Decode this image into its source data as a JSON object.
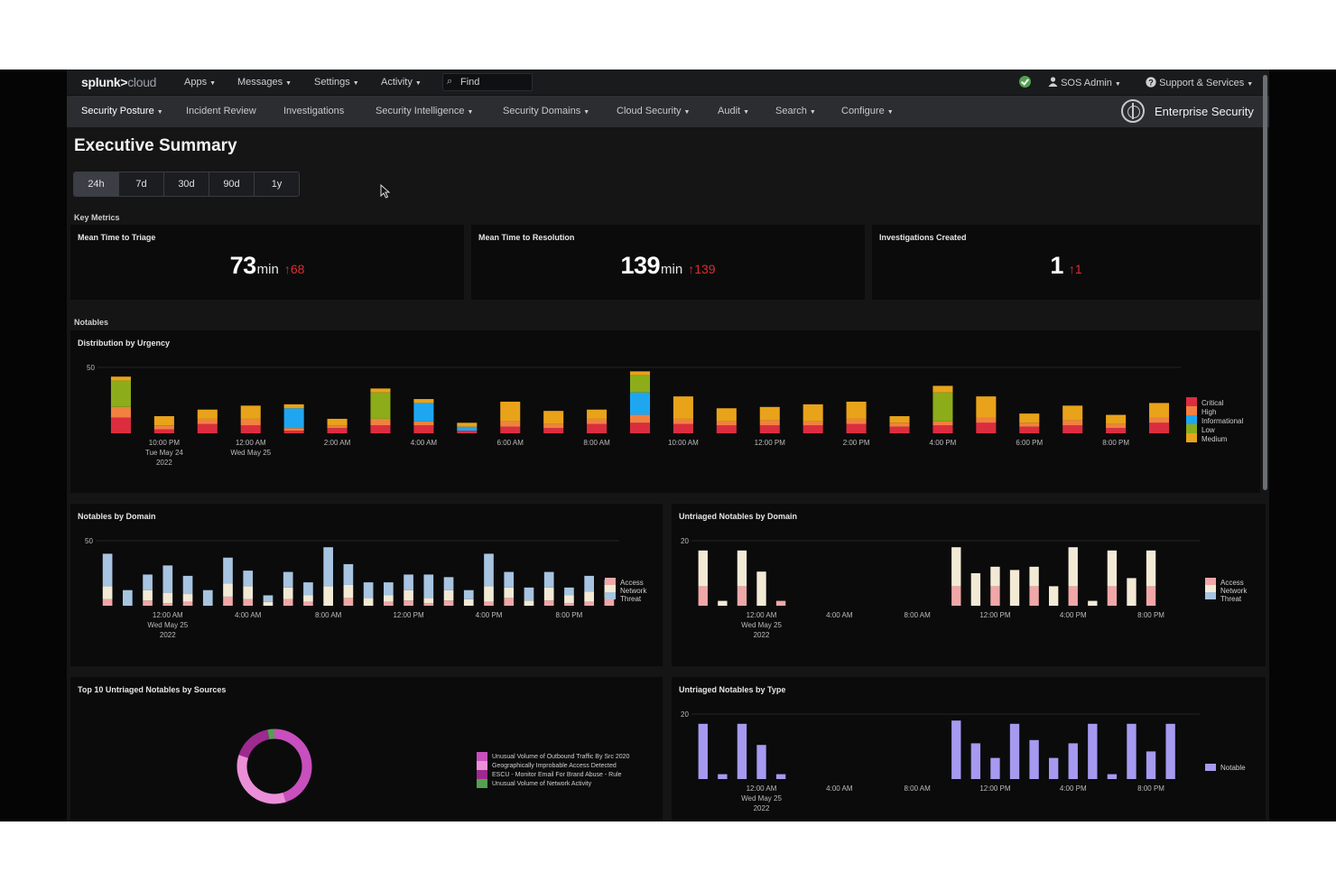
{
  "topbar": {
    "logo_main": "splunk>",
    "logo_sub": "cloud",
    "menus": [
      {
        "label": "Apps",
        "icon": "chevron-down-icon"
      },
      {
        "label": "Messages",
        "icon": "chevron-down-icon"
      },
      {
        "label": "Settings",
        "icon": "chevron-down-icon"
      },
      {
        "label": "Activity",
        "icon": "chevron-down-icon"
      }
    ],
    "find_placeholder": "Find",
    "status_icon": "check-circle-icon",
    "user": "SOS Admin",
    "support": "Support & Services"
  },
  "nav": {
    "items": [
      {
        "label": "Security Posture",
        "active": true
      },
      {
        "label": "Incident Review"
      },
      {
        "label": "Investigations"
      },
      {
        "label": "Security Intelligence",
        "dropdown": true
      },
      {
        "label": "Security Domains",
        "dropdown": true
      },
      {
        "label": "Cloud Security",
        "dropdown": true
      },
      {
        "label": "Audit",
        "dropdown": true
      },
      {
        "label": "Search",
        "dropdown": true
      },
      {
        "label": "Configure",
        "dropdown": true
      }
    ],
    "app_name": "Enterprise Security",
    "app_icon": "globe-icon"
  },
  "page": {
    "title": "Executive Summary",
    "ranges": [
      "24h",
      "7d",
      "30d",
      "90d",
      "1y"
    ],
    "selected_range": "24h",
    "key_metrics_label": "Key Metrics",
    "notables_label": "Notables"
  },
  "metrics": [
    {
      "title": "Mean Time to Triage",
      "value": "73",
      "unit": "min",
      "delta": "68"
    },
    {
      "title": "Mean Time to Resolution",
      "value": "139",
      "unit": "min",
      "delta": "139"
    },
    {
      "title": "Investigations Created",
      "value": "1",
      "unit": "",
      "delta": "1"
    }
  ],
  "colors": {
    "critical": "#dc2d3f",
    "high": "#f1813f",
    "informational": "#1ea7f0",
    "low": "#8cac1a",
    "medium": "#e8a31a",
    "access": "#f0a7a7",
    "network": "#f2ead5",
    "threat": "#a7c4e0",
    "notable": "#a59af0"
  },
  "chart_data": [
    {
      "title": "Distribution by Urgency",
      "type": "bar",
      "stacked": true,
      "ylim": [
        0,
        50
      ],
      "yticks": [
        "50"
      ],
      "xlabels": [
        {
          "index": 1,
          "lines": [
            "10:00 PM",
            "Tue May 24",
            "2022"
          ]
        },
        {
          "index": 3,
          "lines": [
            "12:00 AM",
            "Wed May 25"
          ]
        },
        {
          "index": 5,
          "lines": [
            "2:00 AM"
          ]
        },
        {
          "index": 7,
          "lines": [
            "4:00 AM"
          ]
        },
        {
          "index": 9,
          "lines": [
            "6:00 AM"
          ]
        },
        {
          "index": 11,
          "lines": [
            "8:00 AM"
          ]
        },
        {
          "index": 13,
          "lines": [
            "10:00 AM"
          ]
        },
        {
          "index": 15,
          "lines": [
            "12:00 PM"
          ]
        },
        {
          "index": 17,
          "lines": [
            "2:00 PM"
          ]
        },
        {
          "index": 19,
          "lines": [
            "4:00 PM"
          ]
        },
        {
          "index": 21,
          "lines": [
            "6:00 PM"
          ]
        },
        {
          "index": 23,
          "lines": [
            "8:00 PM"
          ]
        }
      ],
      "series": [
        {
          "name": "Critical",
          "color": "#dc2d3f",
          "values": [
            12,
            3,
            7,
            6,
            2,
            4,
            6,
            6,
            2,
            5,
            4,
            7,
            8,
            7,
            6,
            6,
            6,
            7,
            5,
            6,
            8,
            5,
            6,
            4,
            8
          ]
        },
        {
          "name": "High",
          "color": "#f1813f",
          "values": [
            8,
            3,
            4,
            5,
            2,
            2,
            5,
            3,
            0,
            4,
            3,
            4,
            6,
            4,
            3,
            4,
            3,
            4,
            3,
            3,
            4,
            3,
            4,
            3,
            4
          ]
        },
        {
          "name": "Informational",
          "color": "#1ea7f0",
          "values": [
            0,
            0,
            0,
            0,
            15,
            0,
            0,
            14,
            3,
            0,
            0,
            0,
            17,
            0,
            0,
            0,
            0,
            0,
            0,
            0,
            0,
            0,
            0,
            0,
            0
          ]
        },
        {
          "name": "Low",
          "color": "#8cac1a",
          "values": [
            20,
            0,
            0,
            0,
            0,
            0,
            20,
            0,
            0,
            0,
            0,
            0,
            13,
            0,
            0,
            0,
            0,
            0,
            0,
            22,
            0,
            0,
            0,
            0,
            0
          ]
        },
        {
          "name": "Medium",
          "color": "#e8a31a",
          "values": [
            3,
            7,
            7,
            10,
            3,
            5,
            3,
            3,
            3,
            15,
            10,
            7,
            3,
            17,
            10,
            10,
            13,
            13,
            5,
            5,
            16,
            7,
            11,
            7,
            11
          ]
        }
      ]
    },
    {
      "title": "Notables by Domain",
      "type": "bar",
      "stacked": true,
      "ylim": [
        0,
        50
      ],
      "yticks": [
        "50"
      ],
      "xlabels": [
        {
          "index": 3,
          "lines": [
            "12:00 AM",
            "Wed May 25",
            "2022"
          ]
        },
        {
          "index": 7,
          "lines": [
            "4:00 AM"
          ]
        },
        {
          "index": 11,
          "lines": [
            "8:00 AM"
          ]
        },
        {
          "index": 15,
          "lines": [
            "12:00 PM"
          ]
        },
        {
          "index": 19,
          "lines": [
            "4:00 PM"
          ]
        },
        {
          "index": 23,
          "lines": [
            "8:00 PM"
          ]
        }
      ],
      "series": [
        {
          "name": "Access",
          "color": "#f0a7a7",
          "values": [
            5,
            0,
            4,
            2,
            3,
            0,
            7,
            5,
            0,
            5,
            3,
            0,
            6,
            0,
            3,
            4,
            2,
            4,
            0,
            3,
            6,
            0,
            4,
            2,
            3,
            6
          ]
        },
        {
          "name": "Network",
          "color": "#f2ead5",
          "values": [
            10,
            0,
            8,
            8,
            6,
            0,
            10,
            10,
            3,
            9,
            5,
            15,
            10,
            6,
            5,
            8,
            4,
            8,
            5,
            12,
            8,
            4,
            10,
            6,
            8,
            10
          ]
        },
        {
          "name": "Threat",
          "color": "#a7c4e0",
          "values": [
            25,
            12,
            12,
            21,
            14,
            12,
            20,
            12,
            5,
            12,
            10,
            30,
            16,
            12,
            10,
            12,
            18,
            10,
            7,
            25,
            12,
            10,
            12,
            6,
            12,
            4
          ]
        }
      ]
    },
    {
      "title": "Untriaged Notables by Domain",
      "type": "bar",
      "stacked": true,
      "ylim": [
        0,
        20
      ],
      "yticks": [
        "20"
      ],
      "xlabels": [
        {
          "index": 3,
          "lines": [
            "12:00 AM",
            "Wed May 25",
            "2022"
          ]
        },
        {
          "index": 7,
          "lines": [
            "4:00 AM"
          ]
        },
        {
          "index": 11,
          "lines": [
            "8:00 AM"
          ]
        },
        {
          "index": 15,
          "lines": [
            "12:00 PM"
          ]
        },
        {
          "index": 19,
          "lines": [
            "4:00 PM"
          ]
        },
        {
          "index": 23,
          "lines": [
            "8:00 PM"
          ]
        }
      ],
      "series": [
        {
          "name": "Access",
          "color": "#f0a7a7",
          "values": [
            6,
            0,
            6,
            0,
            1.5,
            0,
            0,
            0,
            0,
            0,
            0,
            0,
            0,
            6,
            0,
            6,
            0,
            6,
            0,
            6,
            0,
            6,
            0,
            6,
            0,
            0
          ]
        },
        {
          "name": "Network",
          "color": "#f2ead5",
          "values": [
            11,
            1.5,
            11,
            10.5,
            0,
            0,
            0,
            0,
            0,
            0,
            0,
            0,
            0,
            12,
            10,
            6,
            11,
            6,
            6,
            12,
            1.5,
            11,
            8.5,
            11,
            0,
            0
          ]
        },
        {
          "name": "Threat",
          "color": "#a7c4e0",
          "values": [
            0,
            0,
            0,
            0,
            0,
            0,
            0,
            0,
            0,
            0,
            0,
            0,
            0,
            0,
            0,
            0,
            0,
            0,
            0,
            0,
            0,
            0,
            0,
            0,
            0,
            0
          ]
        }
      ]
    },
    {
      "title": "Top 10 Untriaged Notables by Sources",
      "type": "pie",
      "donut": true,
      "slices": [
        {
          "label": "Unusual Volume of Outbound Traffic By Src 2020",
          "value": 45,
          "color": "#c84fbd"
        },
        {
          "label": "Geographically Improbable Access Detected",
          "value": 35,
          "color": "#eb8fd8"
        },
        {
          "label": "ESCU - Monitor Email For Brand Abuse - Rule",
          "value": 17,
          "color": "#9c2a8f"
        },
        {
          "label": "Unusual Volume of Network Activity",
          "value": 3,
          "color": "#53a051"
        }
      ]
    },
    {
      "title": "Untriaged Notables by Type",
      "type": "bar",
      "ylim": [
        0,
        20
      ],
      "yticks": [
        "20"
      ],
      "xlabels": [
        {
          "index": 3,
          "lines": [
            "12:00 AM",
            "Wed May 25",
            "2022"
          ]
        },
        {
          "index": 7,
          "lines": [
            "4:00 AM"
          ]
        },
        {
          "index": 11,
          "lines": [
            "8:00 AM"
          ]
        },
        {
          "index": 15,
          "lines": [
            "12:00 PM"
          ]
        },
        {
          "index": 19,
          "lines": [
            "4:00 PM"
          ]
        },
        {
          "index": 23,
          "lines": [
            "8:00 PM"
          ]
        }
      ],
      "series": [
        {
          "name": "Notable",
          "color": "#a59af0",
          "values": [
            17,
            1.5,
            17,
            10.5,
            1.5,
            0,
            0,
            0,
            0,
            0,
            0,
            0,
            0,
            18,
            11,
            6.5,
            17,
            12,
            6.5,
            11,
            17,
            1.5,
            17,
            8.5,
            17,
            0
          ]
        }
      ]
    }
  ]
}
